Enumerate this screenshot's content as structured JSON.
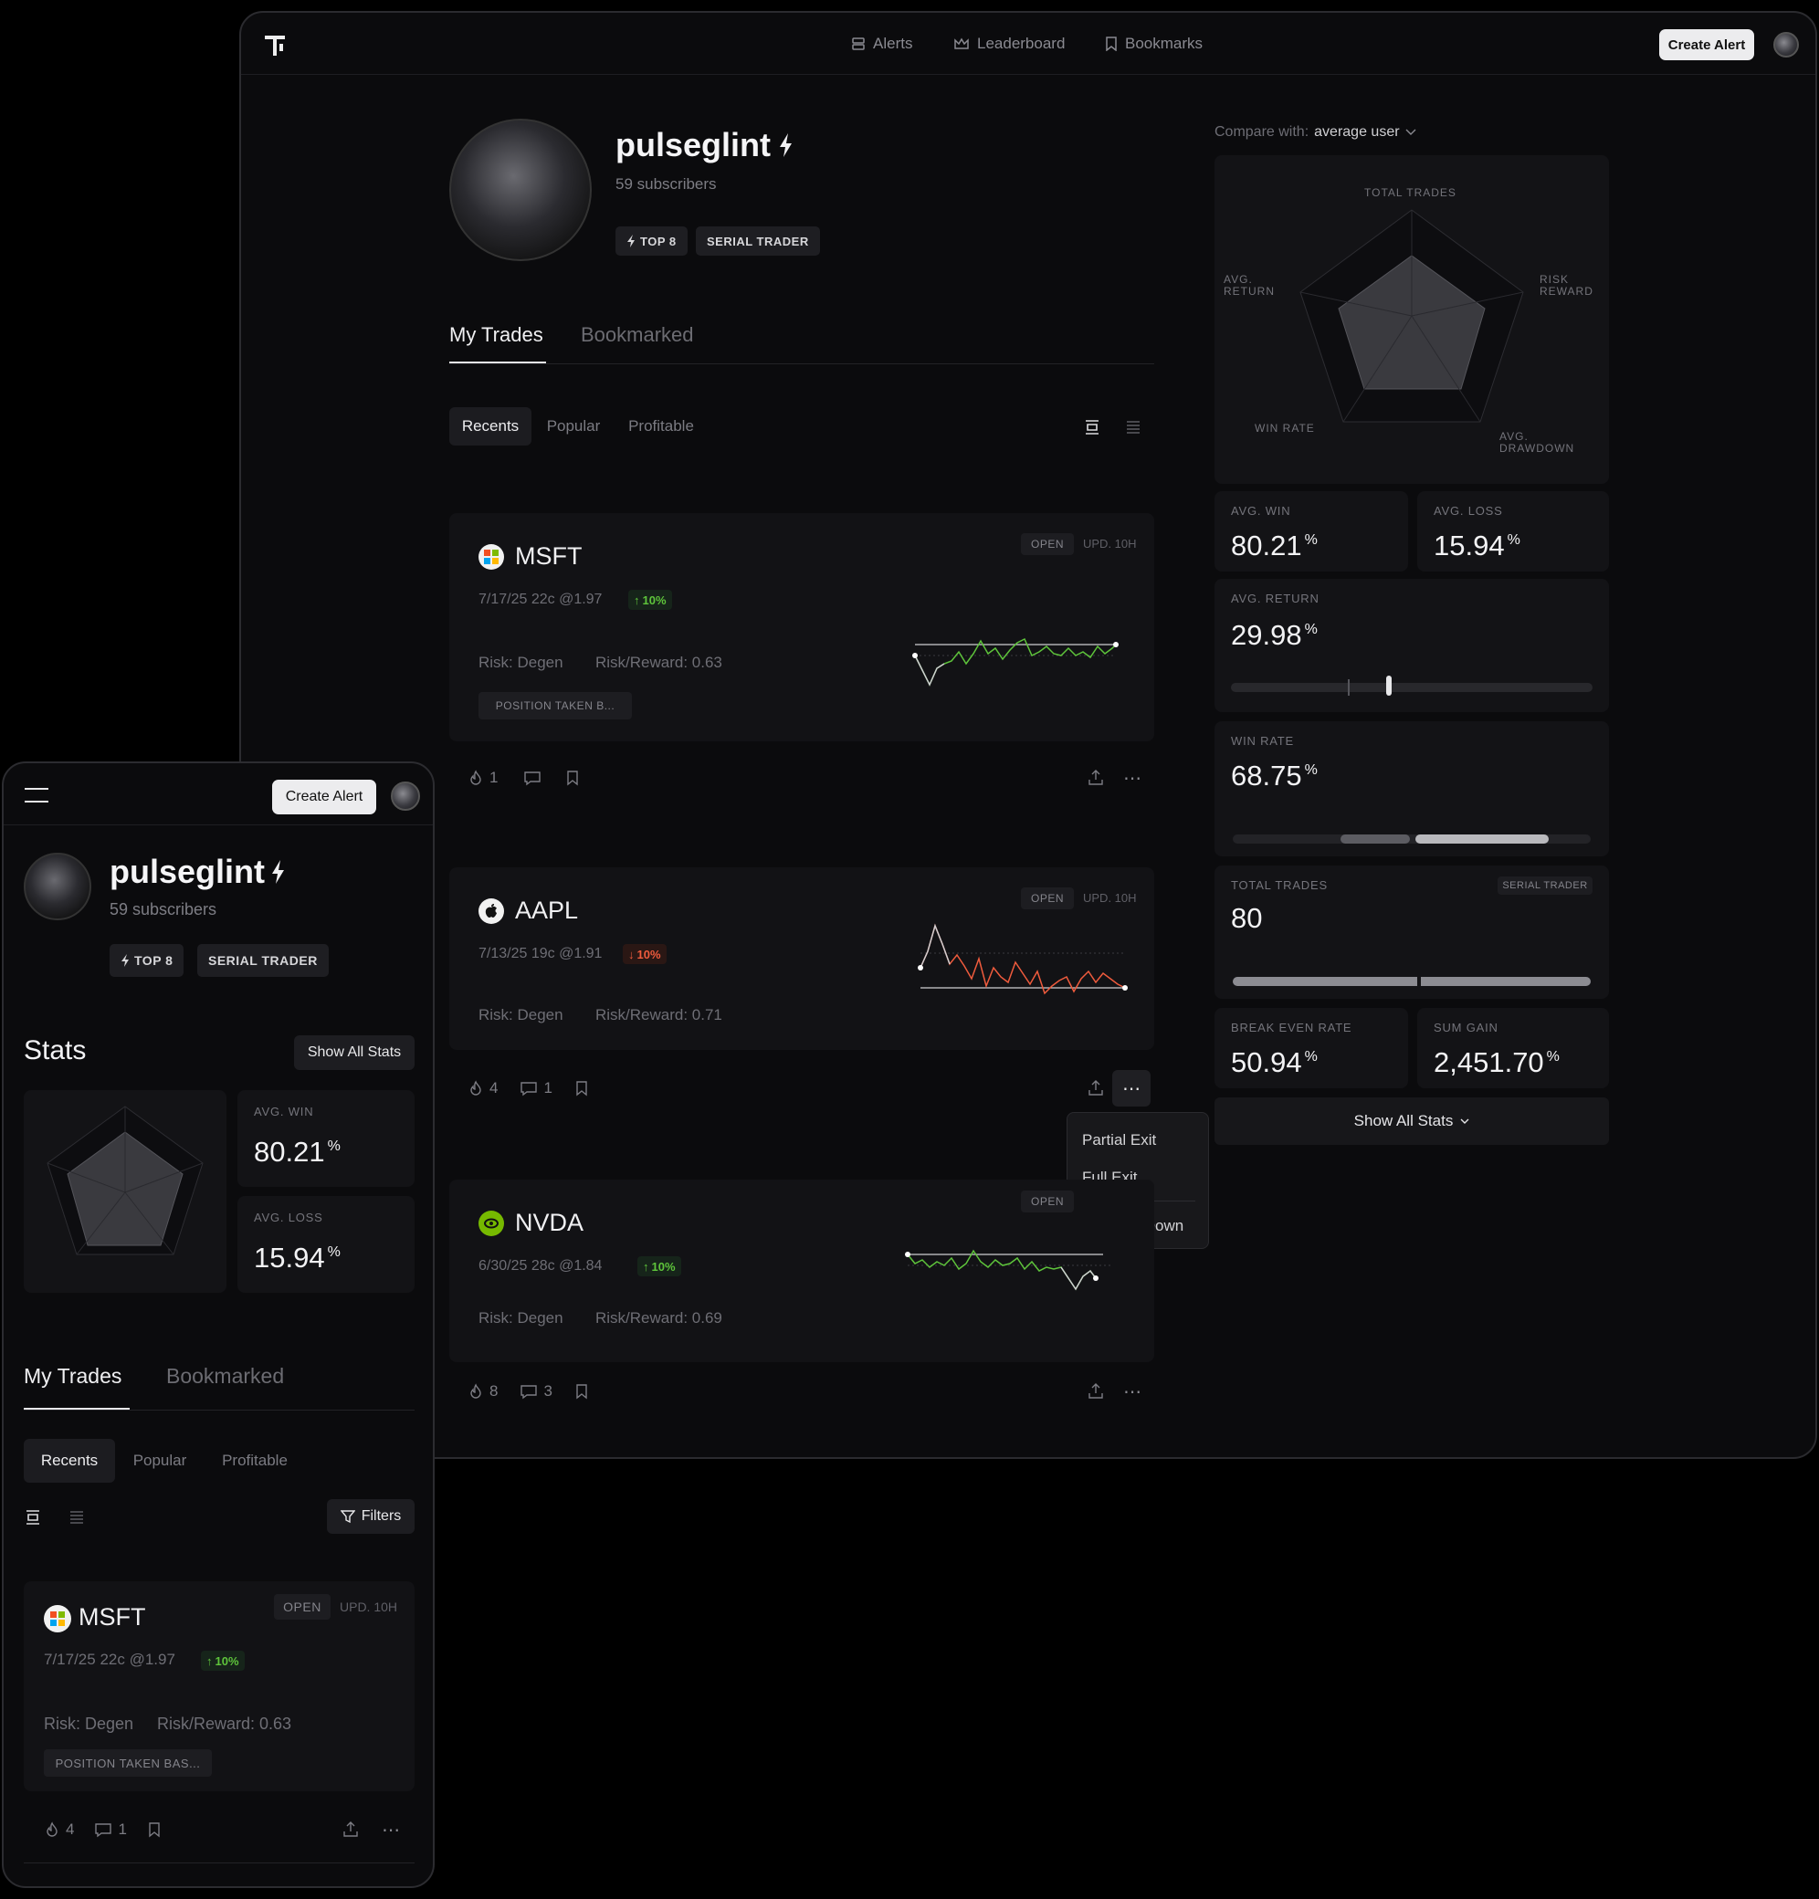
{
  "desktop": {
    "nav": {
      "alerts": "Alerts",
      "leaderboard": "Leaderboard",
      "bookmarks": "Bookmarks",
      "create_alert": "Create Alert"
    },
    "profile": {
      "username": "pulseglint",
      "subscribers": "59 subscribers",
      "badge_top": "TOP 8",
      "badge_serial": "SERIAL TRADER"
    },
    "tabs": [
      "My Trades",
      "Bookmarked"
    ],
    "filters": [
      "Recents",
      "Popular",
      "Profitable"
    ],
    "trades": [
      {
        "ticker": "MSFT",
        "meta": "7/17/25 22c @1.97",
        "change": "10%",
        "direction": "up",
        "status": "OPEN",
        "updated": "UPD. 10H",
        "risk": "Risk: Degen",
        "risk_reward": "Risk/Reward: 0.63",
        "note": "POSITION TAKEN B...",
        "likes": "1",
        "comments": ""
      },
      {
        "ticker": "AAPL",
        "meta": "7/13/25 19c @1.91",
        "change": "10%",
        "direction": "down",
        "status": "OPEN",
        "updated": "UPD. 10H",
        "risk": "Risk: Degen",
        "risk_reward": "Risk/Reward: 0.71",
        "likes": "4",
        "comments": "1"
      },
      {
        "ticker": "NVDA",
        "meta": "6/30/25 28c @1.84",
        "change": "10%",
        "direction": "up",
        "status": "OPEN",
        "risk": "Risk: Degen",
        "risk_reward": "Risk/Reward: 0.69",
        "likes": "8",
        "comments": "3"
      }
    ],
    "menu": [
      "Partial Exit",
      "Full Exit",
      "Average Down"
    ],
    "compare": {
      "label": "Compare with:",
      "value": "average user"
    },
    "radar_labels": {
      "total_trades": "TOTAL TRADES",
      "avg_return_1": "AVG.",
      "avg_return_2": "RETURN",
      "risk_reward_1": "RISK",
      "risk_reward_2": "REWARD",
      "win_rate": "WIN RATE",
      "avg_drawdown_1": "AVG.",
      "avg_drawdown_2": "DRAWDOWN"
    },
    "stats": {
      "avg_win": {
        "label": "AVG. WIN",
        "value": "80.21",
        "unit": "%"
      },
      "avg_loss": {
        "label": "AVG. LOSS",
        "value": "15.94",
        "unit": "%"
      },
      "avg_return": {
        "label": "AVG. RETURN",
        "value": "29.98",
        "unit": "%"
      },
      "win_rate": {
        "label": "WIN RATE",
        "value": "68.75",
        "unit": "%"
      },
      "total_trades": {
        "label": "TOTAL TRADES",
        "value": "80",
        "badge": "SERIAL TRADER"
      },
      "break_even": {
        "label": "BREAK EVEN RATE",
        "value": "50.94",
        "unit": "%"
      },
      "sum_gain": {
        "label": "SUM GAIN",
        "value": "2,451.70",
        "unit": "%"
      }
    },
    "show_all_stats": "Show All Stats"
  },
  "mobile": {
    "create_alert": "Create Alert",
    "username": "pulseglint",
    "subscribers": "59 subscribers",
    "badge_top": "TOP 8",
    "badge_serial": "SERIAL TRADER",
    "stats_title": "Stats",
    "show_all_stats": "Show All Stats",
    "avg_win": {
      "label": "AVG. WIN",
      "value": "80.21",
      "unit": "%"
    },
    "avg_loss": {
      "label": "AVG. LOSS",
      "value": "15.94",
      "unit": "%"
    },
    "tabs": [
      "My Trades",
      "Bookmarked"
    ],
    "filters": [
      "Recents",
      "Popular",
      "Profitable"
    ],
    "filters_button": "Filters",
    "trade": {
      "ticker": "MSFT",
      "meta": "7/17/25 22c @1.97",
      "change": "10%",
      "status": "OPEN",
      "updated": "UPD. 10H",
      "risk": "Risk: Degen",
      "risk_reward": "Risk/Reward: 0.63",
      "note": "POSITION TAKEN BAS...",
      "likes": "4",
      "comments": "1"
    }
  },
  "colors": {
    "up": "#5ec43b",
    "down": "#ef5b3d",
    "bg": "#0b0b0d",
    "card": "#121215"
  }
}
